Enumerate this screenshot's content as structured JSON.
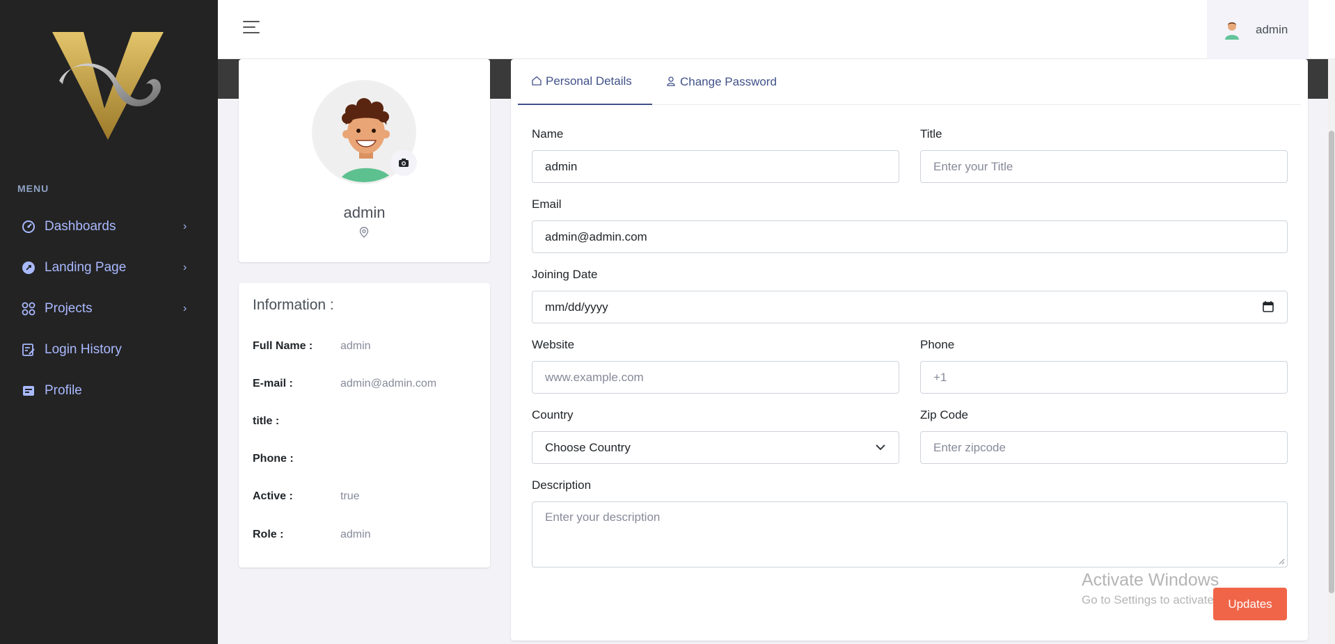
{
  "sidebar": {
    "menu_title": "MENU",
    "items": [
      {
        "label": "Dashboards",
        "icon": "dashboard-gauge-icon",
        "has_chevron": true
      },
      {
        "label": "Landing Page",
        "icon": "rocket-icon",
        "has_chevron": true
      },
      {
        "label": "Projects",
        "icon": "apps-grid-icon",
        "has_chevron": true
      },
      {
        "label": "Login History",
        "icon": "edit-list-icon",
        "has_chevron": false
      },
      {
        "label": "Profile",
        "icon": "profile-card-icon",
        "has_chevron": false
      }
    ]
  },
  "header": {
    "user_name": "admin"
  },
  "profile": {
    "name": "admin"
  },
  "information": {
    "title": "Information :",
    "rows": [
      {
        "key": "Full Name :",
        "value": "admin"
      },
      {
        "key": "E-mail :",
        "value": "admin@admin.com"
      },
      {
        "key": "title :",
        "value": ""
      },
      {
        "key": "Phone :",
        "value": ""
      },
      {
        "key": "Active :",
        "value": "true"
      },
      {
        "key": "Role :",
        "value": "admin"
      }
    ]
  },
  "tabs": [
    {
      "label": "Personal Details",
      "active": true
    },
    {
      "label": "Change Password",
      "active": false
    }
  ],
  "form": {
    "name": {
      "label": "Name",
      "value": "admin"
    },
    "title": {
      "label": "Title",
      "placeholder": "Enter your Title"
    },
    "email": {
      "label": "Email",
      "value": "admin@admin.com"
    },
    "joining_date": {
      "label": "Joining Date",
      "value": "mm/dd/yyyy"
    },
    "website": {
      "label": "Website",
      "placeholder": "www.example.com"
    },
    "phone": {
      "label": "Phone",
      "placeholder": "+1"
    },
    "country": {
      "label": "Country",
      "value": "Choose Country"
    },
    "zip": {
      "label": "Zip Code",
      "placeholder": "Enter zipcode"
    },
    "description": {
      "label": "Description",
      "placeholder": "Enter your description"
    },
    "submit_label": "Updates"
  },
  "watermark": {
    "line1": "Activate Windows",
    "line2": "Go to Settings to activate"
  },
  "colors": {
    "sidebar_bg": "#232323",
    "nav_text": "#a9b9ff",
    "accent": "#405189",
    "update_button": "#f06548"
  }
}
